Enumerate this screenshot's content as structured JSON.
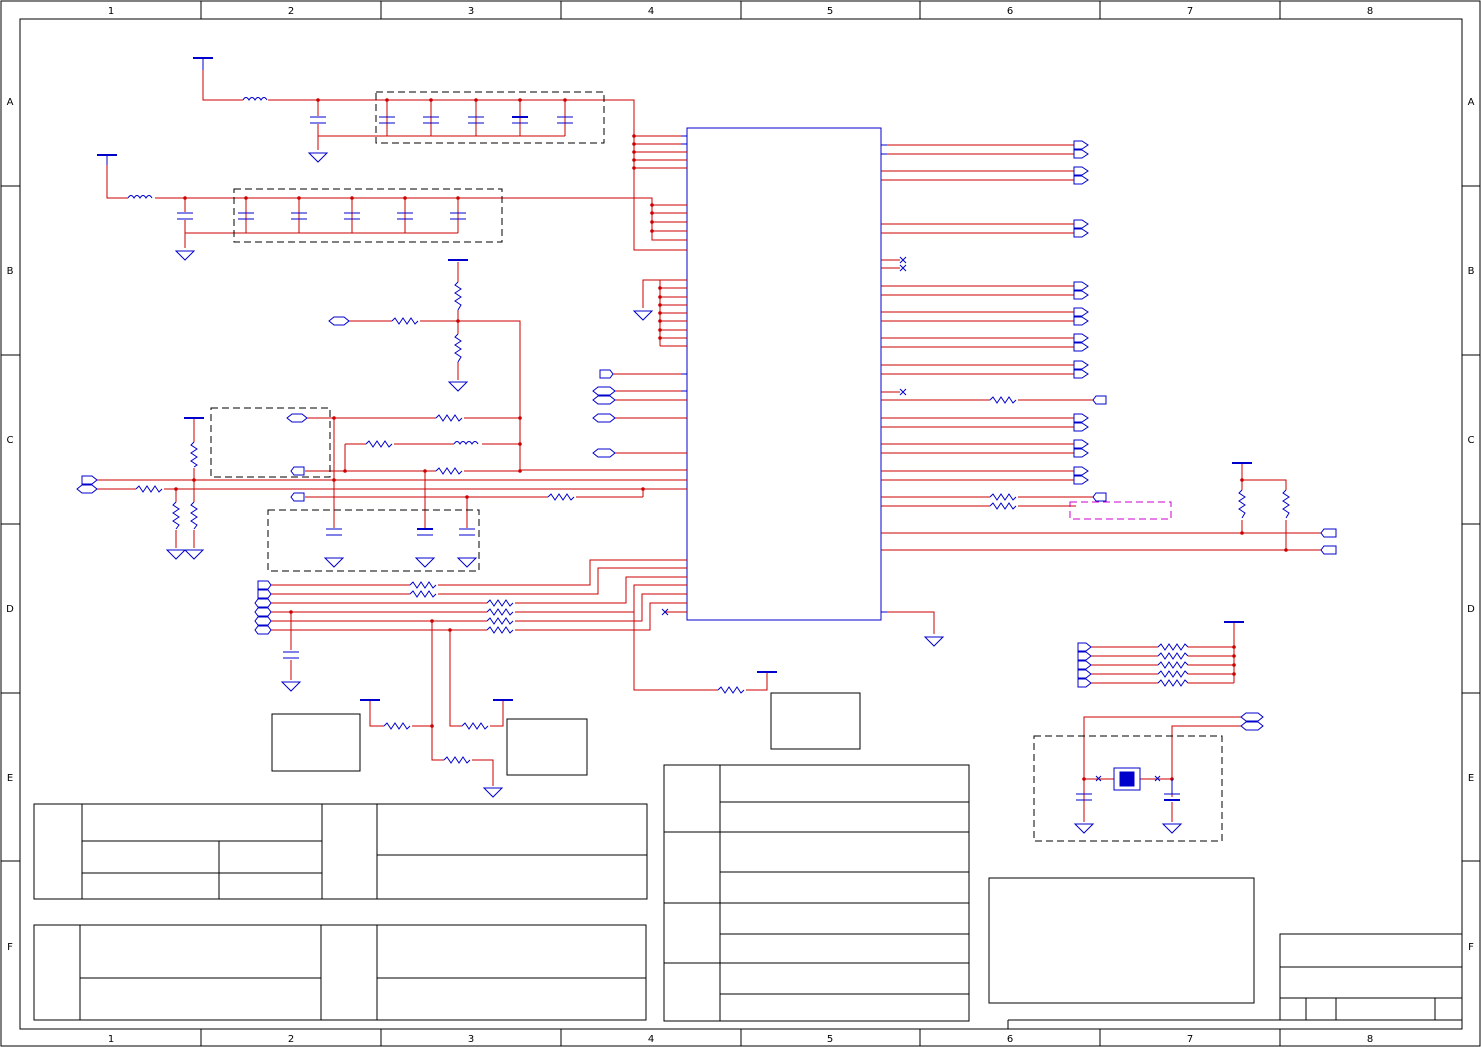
{
  "colors": {
    "border": "#000000",
    "wire": "#cc0000",
    "component": "#0000cc",
    "annotation": "#cc00cc",
    "background": "#ffffff"
  },
  "frame": {
    "columns": [
      "1",
      "2",
      "3",
      "4",
      "5",
      "6",
      "7",
      "8"
    ],
    "rows": [
      "A",
      "B",
      "C",
      "D",
      "E",
      "F"
    ]
  }
}
